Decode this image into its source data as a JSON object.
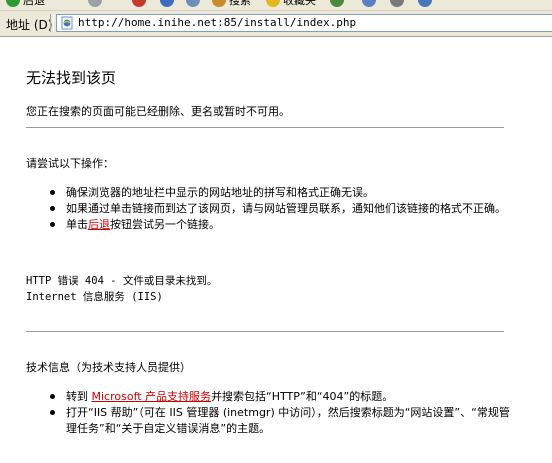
{
  "toolbar": {
    "items": [
      {
        "label": "后退",
        "icon": "back-icon"
      },
      {
        "label": "",
        "icon": "forward-icon"
      },
      {
        "label": "",
        "icon": "stop-icon"
      },
      {
        "label": "",
        "icon": "refresh-icon"
      },
      {
        "label": "",
        "icon": "home-icon"
      },
      {
        "label": "搜索",
        "icon": "search-icon"
      },
      {
        "label": "收藏夹",
        "icon": "favorites-icon"
      },
      {
        "label": "",
        "icon": "history-icon"
      }
    ]
  },
  "address_bar": {
    "label": "地址 (D)",
    "url": "http://home.inihe.net:85/install/index.php"
  },
  "page": {
    "title": "无法找到该页",
    "subtitle": "您正在搜索的页面可能已经删除、更名或暂时不可用。",
    "section1_heading": "请尝试以下操作：",
    "section1_items": {
      "item1": "确保浏览器的地址栏中显示的网站地址的拼写和格式正确无误。",
      "item2": "如果通过单击链接而到达了该网页，请与网站管理员联系，通知他们该链接的格式不正确。",
      "item3_prefix": "单击",
      "item3_link": "后退",
      "item3_suffix": "按钮尝试另一个链接。"
    },
    "error_line1": "HTTP 错误 404 - 文件或目录未找到。",
    "error_line2": "Internet 信息服务 (IIS)",
    "section2_heading": "技术信息（为技术支持人员提供）",
    "section2_items": {
      "item1_prefix": "转到 ",
      "item1_link": "Microsoft 产品支持服务",
      "item1_suffix": "并搜索包括“HTTP”和“404”的标题。",
      "item2": "打开“IIS 帮助”（可在 IIS 管理器 (inetmgr) 中访问），然后搜索标题为“网站设置”、“常规管理任务”和“关于自定义错误消息”的主题。"
    }
  },
  "colors": {
    "link": "#cc0000",
    "rule": "#999999",
    "chrome": "#ece9d8"
  }
}
